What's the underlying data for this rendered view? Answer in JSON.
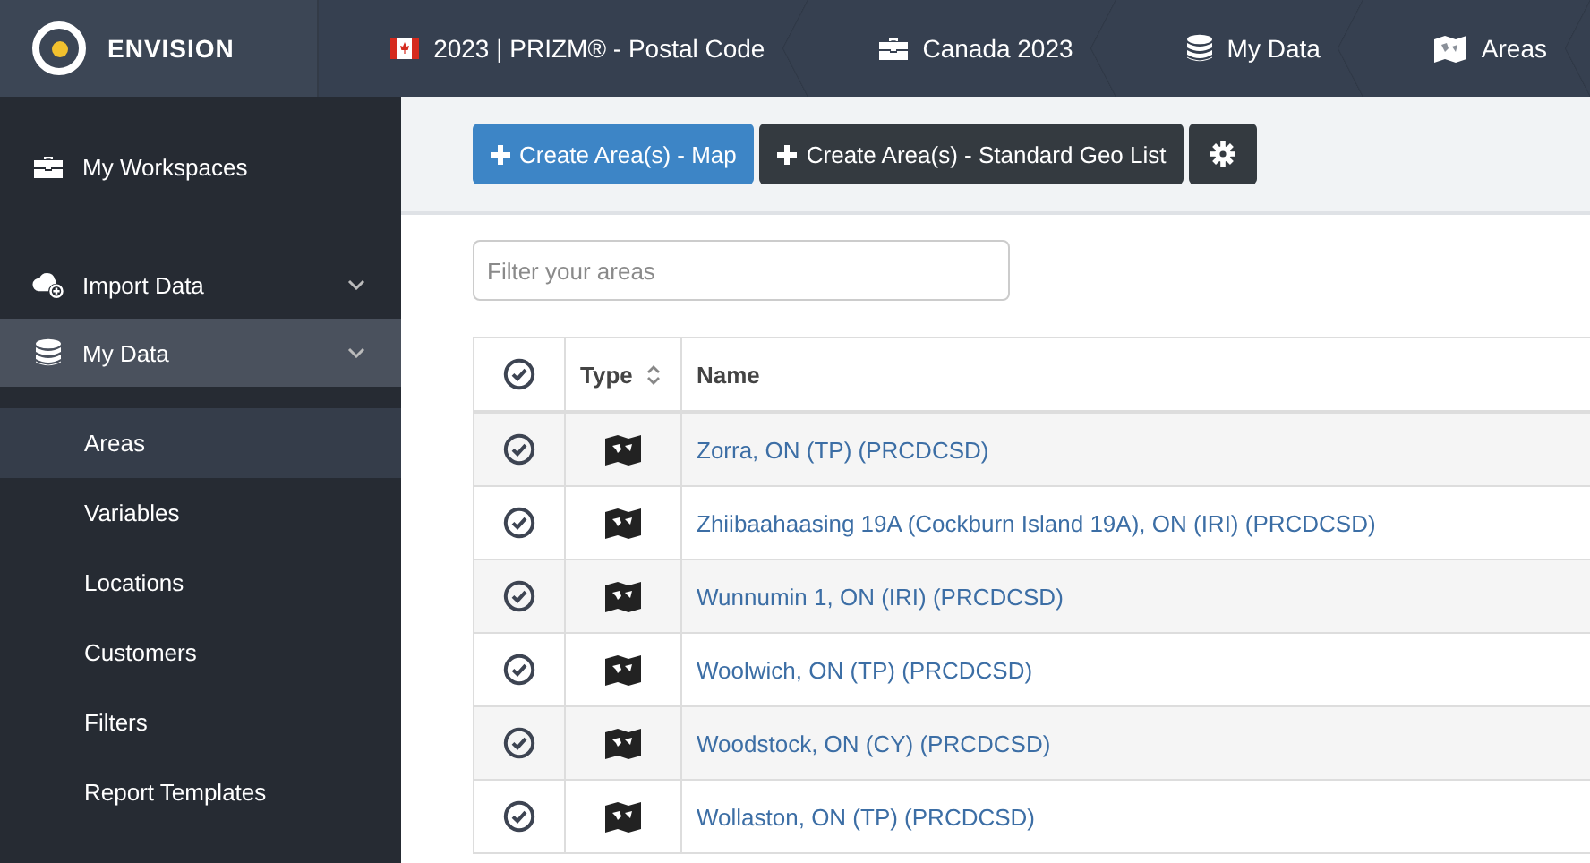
{
  "app": {
    "logo_text": "ENVISION"
  },
  "breadcrumbs": [
    {
      "kind": "flag",
      "label": "2023 | PRIZM® - Postal Code"
    },
    {
      "kind": "briefcase",
      "label": "Canada 2023"
    },
    {
      "kind": "database",
      "label": "My Data"
    },
    {
      "kind": "map",
      "label": "Areas"
    }
  ],
  "sidebar": {
    "items": [
      {
        "kind": "link",
        "label": "My Workspaces",
        "selected": false
      },
      {
        "kind": "group",
        "label": "Import Data",
        "selected": false
      },
      {
        "kind": "group",
        "label": "My Data",
        "selected": true
      },
      {
        "kind": "sub",
        "label": "Areas",
        "selected": true
      },
      {
        "kind": "sub",
        "label": "Variables",
        "selected": false
      },
      {
        "kind": "sub",
        "label": "Locations",
        "selected": false
      },
      {
        "kind": "sub",
        "label": "Customers",
        "selected": false
      },
      {
        "kind": "sub",
        "label": "Filters",
        "selected": false
      },
      {
        "kind": "sub",
        "label": "Report Templates",
        "selected": false
      }
    ]
  },
  "toolbar": {
    "buttons": [
      {
        "kind": "primary",
        "label": "Create Area(s) - Map"
      },
      {
        "kind": "dark",
        "label": "Create Area(s) - Standard Geo List"
      },
      {
        "kind": "settings"
      }
    ]
  },
  "filter": {
    "placeholder": "Filter your areas"
  },
  "table": {
    "columns": [
      {
        "kind": "select"
      },
      {
        "kind": "sortable",
        "label": "Type"
      },
      {
        "kind": "text",
        "label": "Name"
      }
    ],
    "rows": [
      {
        "name": "Zorra, ON (TP) (PRCDCSD)"
      },
      {
        "name": "Zhiibaahaasing 19A (Cockburn Island 19A), ON (IRI) (PRCDCSD)"
      },
      {
        "name": "Wunnumin 1, ON (IRI) (PRCDCSD)"
      },
      {
        "name": "Woolwich, ON (TP) (PRCDCSD)"
      },
      {
        "name": "Woodstock, ON (CY) (PRCDCSD)"
      },
      {
        "name": "Wollaston, ON (TP) (PRCDCSD)"
      }
    ]
  }
}
